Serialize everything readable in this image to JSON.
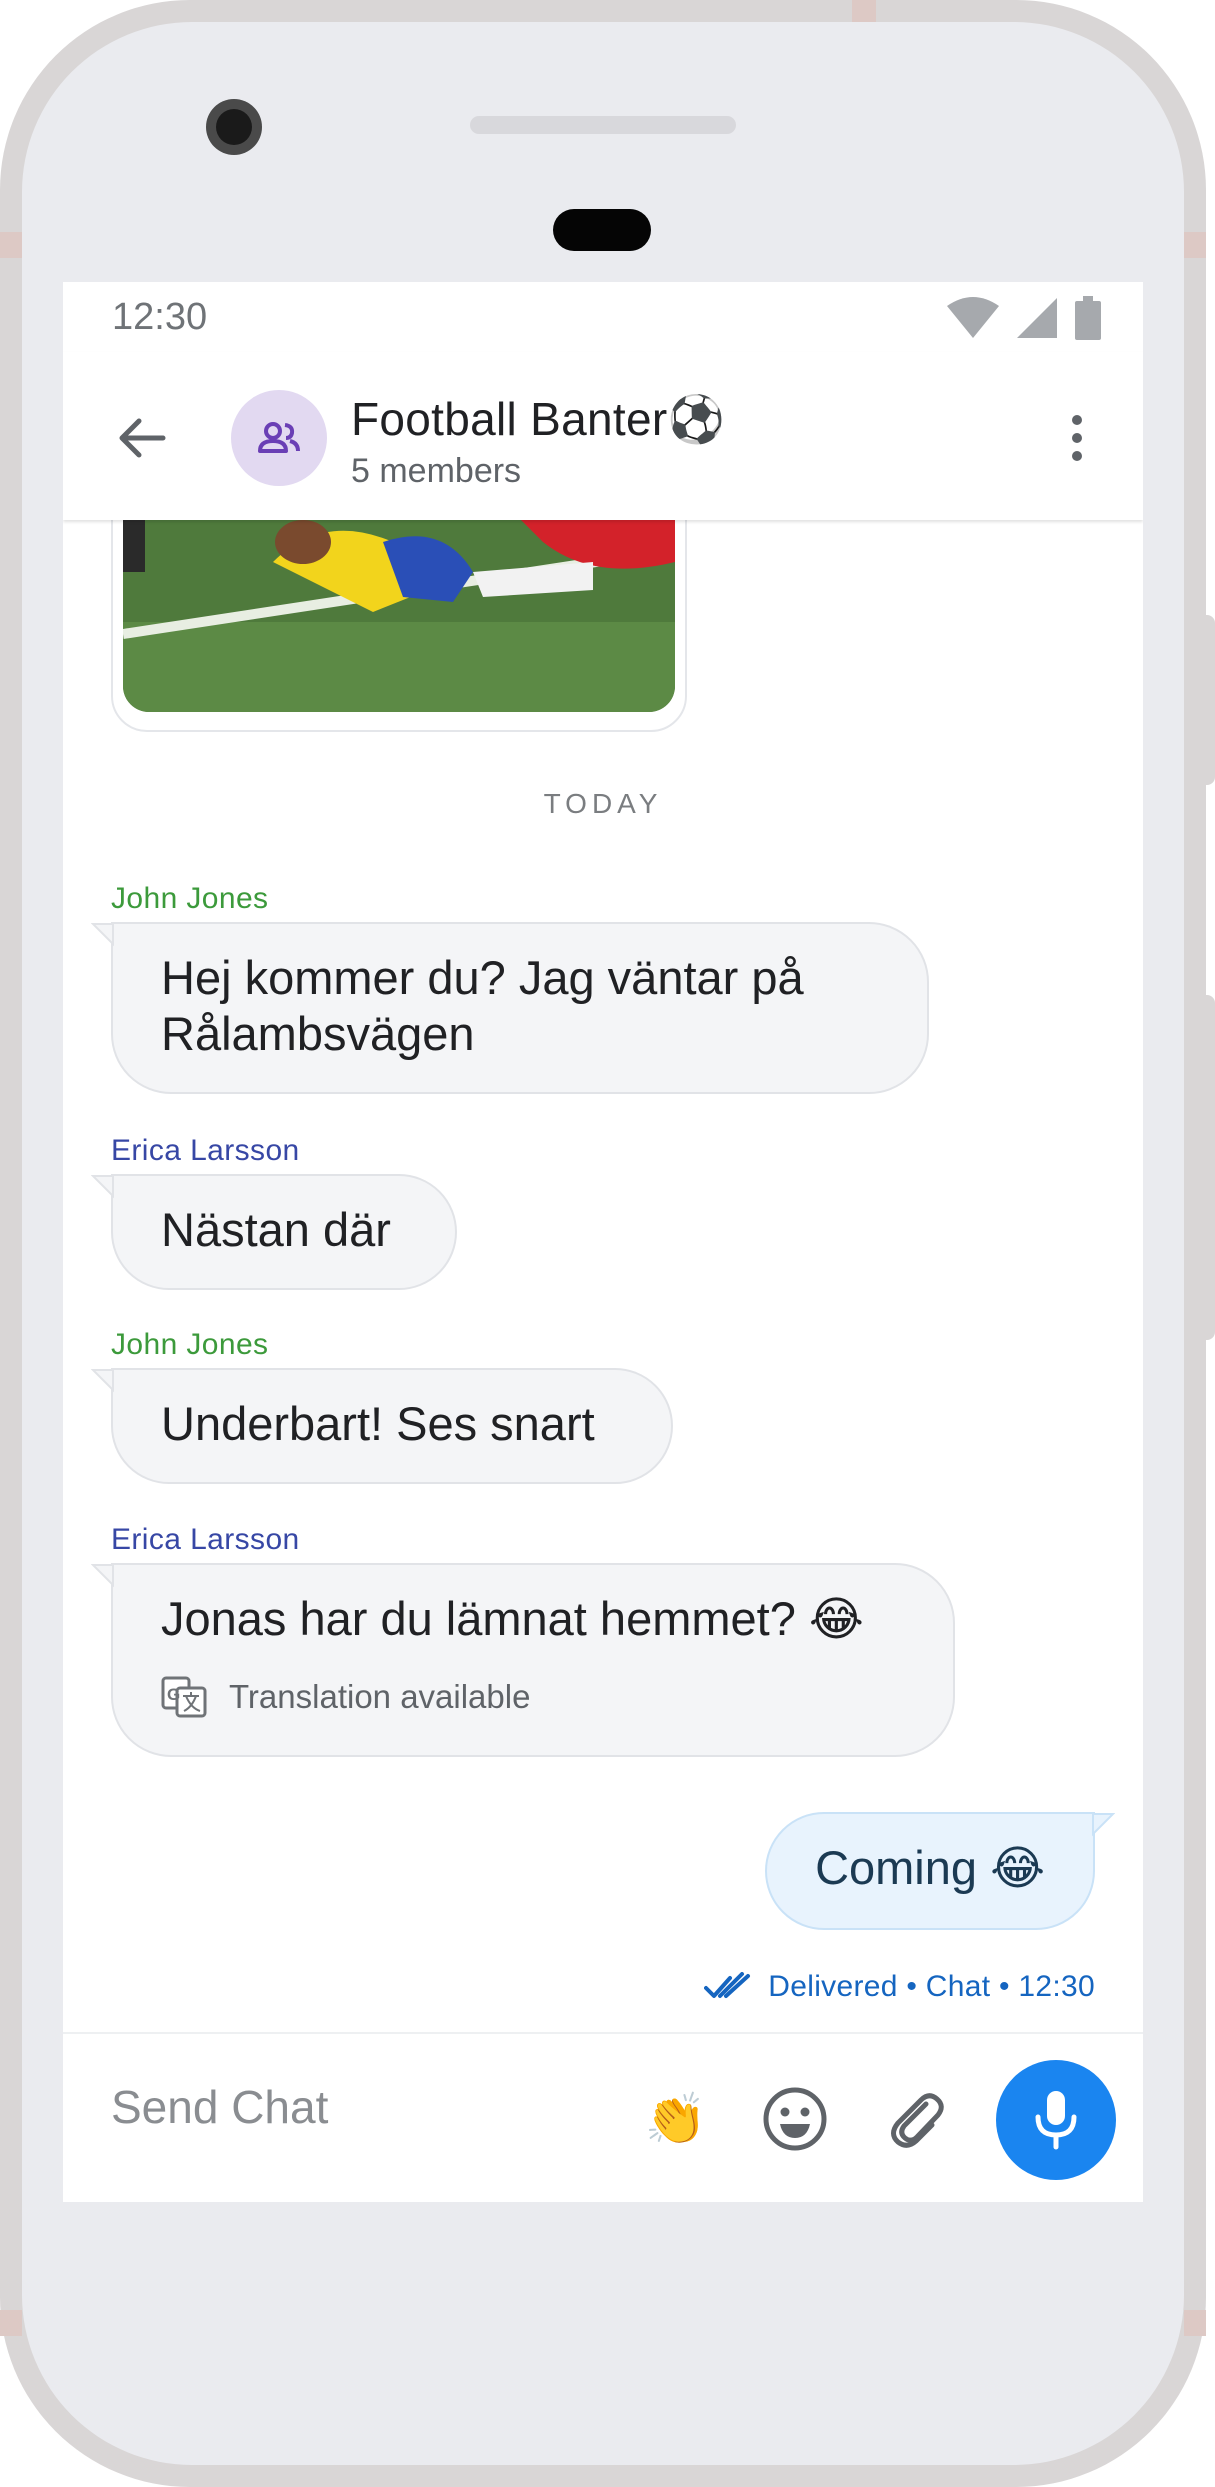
{
  "status_bar": {
    "time": "12:30"
  },
  "header": {
    "title": "Football Banter⚽",
    "subtitle": "5 members"
  },
  "conversation": {
    "day_label": "TODAY",
    "messages": [
      {
        "sender": "John Jones",
        "text": "Hej kommer du? Jag väntar på",
        "text_line2": "Rålambsvägen"
      },
      {
        "sender": "Erica Larsson",
        "text": "Nästan där"
      },
      {
        "sender": "John Jones",
        "text": "Underbart! Ses snart"
      },
      {
        "sender": "Erica Larsson",
        "text": "Jonas har du lämnat hemmet? 😂",
        "translation": "Translation available"
      }
    ],
    "outgoing": {
      "text": "Coming 😂",
      "status": "Delivered • Chat • 12:30"
    }
  },
  "composer": {
    "placeholder": "Send Chat",
    "quick_emoji": "👏"
  },
  "colors": {
    "accent": "#1a85f0",
    "sender_green": "#3c9a3b",
    "sender_blue": "#3747a5",
    "outgoing_bubble": "#e8f3fd"
  },
  "icons": [
    "back-arrow-icon",
    "group-icon",
    "more-vert-icon",
    "wifi-icon",
    "signal-icon",
    "battery-icon",
    "translate-icon",
    "double-check-icon",
    "emoji-icon",
    "attach-icon",
    "mic-icon"
  ]
}
